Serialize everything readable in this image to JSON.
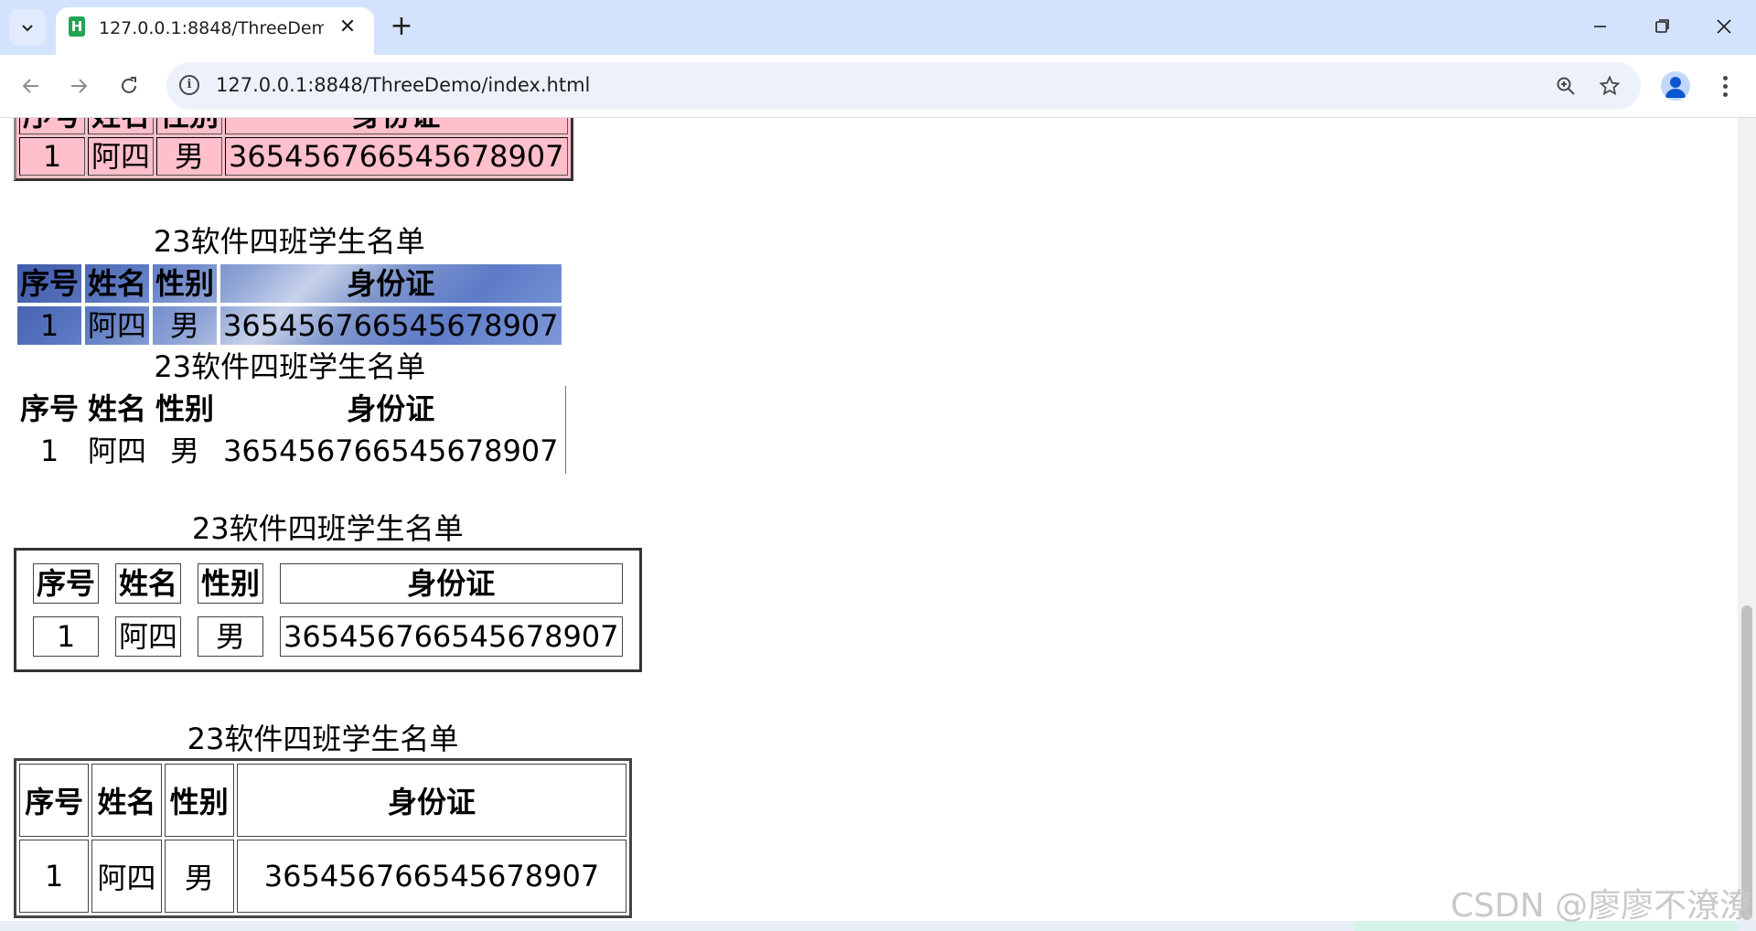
{
  "browser": {
    "tab_title": "127.0.0.1:8848/ThreeDemo/index.html",
    "tab_favicon_letter": "H",
    "url": "127.0.0.1:8848/ThreeDemo/index.html",
    "icons": [
      "tab-search-icon",
      "close-icon",
      "plus-icon",
      "minimize-icon",
      "restore-icon",
      "close-window-icon",
      "back-arrow-icon",
      "forward-arrow-icon",
      "reload-icon",
      "info-icon",
      "zoom-icon",
      "star-icon",
      "profile-icon",
      "more-menu-icon"
    ]
  },
  "page": {
    "caption": "23软件四班学生名单",
    "headers": [
      "序号",
      "姓名",
      "性别",
      "身份证"
    ],
    "row": [
      "1",
      "阿四",
      "男",
      "365456766545678907"
    ]
  },
  "watermark": "CSDN @廖廖不潦潦",
  "colors": {
    "tabstrip": "#d3e3fd",
    "pink_table": "#ffc0cb",
    "favicon": "#23a455"
  }
}
